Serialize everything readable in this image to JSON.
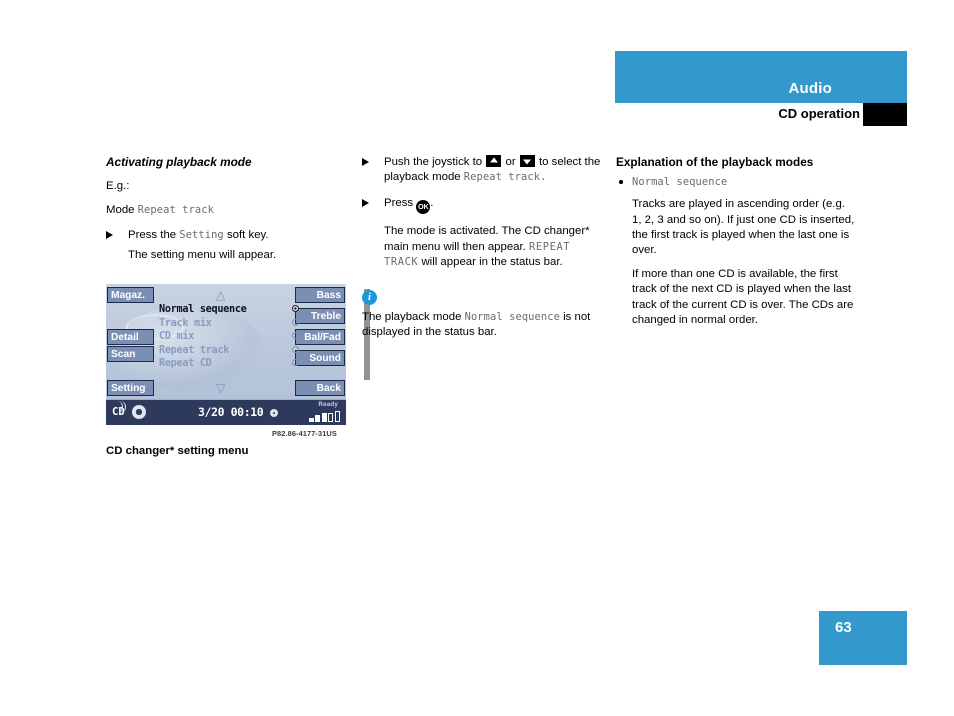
{
  "header": {
    "title": "Audio",
    "subtitle": "CD operation"
  },
  "footer": {
    "page_number": "63"
  },
  "colors": {
    "brand_blue": "#3399cc",
    "info_blue": "#2196d4",
    "display_bg": "#c3cfe0",
    "status_bar": "#2e3a5c",
    "softkey": "#7b8fb5"
  },
  "left_column": {
    "heading": "Activating playback mode",
    "eg_label": "E.g.:",
    "mode_label": "Mode",
    "mode_value": "Repeat track",
    "step1_pre": "Press the",
    "step1_mono": "Setting",
    "step1_post": "soft key.",
    "step1_result": "The setting menu will appear."
  },
  "display": {
    "left_keys": [
      {
        "label": "Magaz."
      },
      {
        "label": "Detail"
      },
      {
        "label": "Scan"
      },
      {
        "label": "Setting"
      }
    ],
    "right_keys": [
      {
        "label": "Bass"
      },
      {
        "label": "Treble"
      },
      {
        "label": "Bal/Fad"
      },
      {
        "label": "Sound"
      },
      {
        "label": "Back"
      }
    ],
    "menu_items": [
      {
        "label": "Normal sequence",
        "selected": true
      },
      {
        "label": "Track mix",
        "selected": false
      },
      {
        "label": "CD mix",
        "selected": false
      },
      {
        "label": "Repeat track",
        "selected": false
      },
      {
        "label": "Repeat CD",
        "selected": false
      }
    ],
    "scroll_up_glyph": "△",
    "scroll_down_glyph": "▽",
    "status_bar": {
      "source": "CD",
      "track": "3/20",
      "time": "00:10",
      "ready_label": "Ready"
    },
    "figure_code": "P82.86-4177-31US",
    "caption": "CD changer* setting menu"
  },
  "middle_column": {
    "step1_pre": "Push the joystick to",
    "step1_or": "or",
    "step1_mid": "to select the playback mode",
    "step1_mono": "Repeat track",
    "step1_end": ".",
    "step2_pre": "Press",
    "step2_end": ".",
    "step2_result_a": "The mode is activated. The CD changer* main menu will then appear.",
    "step2_result_mono": "REPEAT TRACK",
    "step2_result_b": "will appear in the status bar.",
    "info_note_a": "The playback mode",
    "info_note_mono": "Normal sequence",
    "info_note_b": "is not displayed in the status bar."
  },
  "right_column": {
    "heading": "Explanation of the playback modes",
    "item_mono": "Normal sequence",
    "para1": "Tracks are played in ascending order (e.g. 1, 2, 3 and so on). If just one CD is inserted, the first track is played when the last one is over.",
    "para2": "If more than one CD is available, the first track of the next CD is played when the last track of the current CD is over. The CDs are changed in normal order."
  }
}
